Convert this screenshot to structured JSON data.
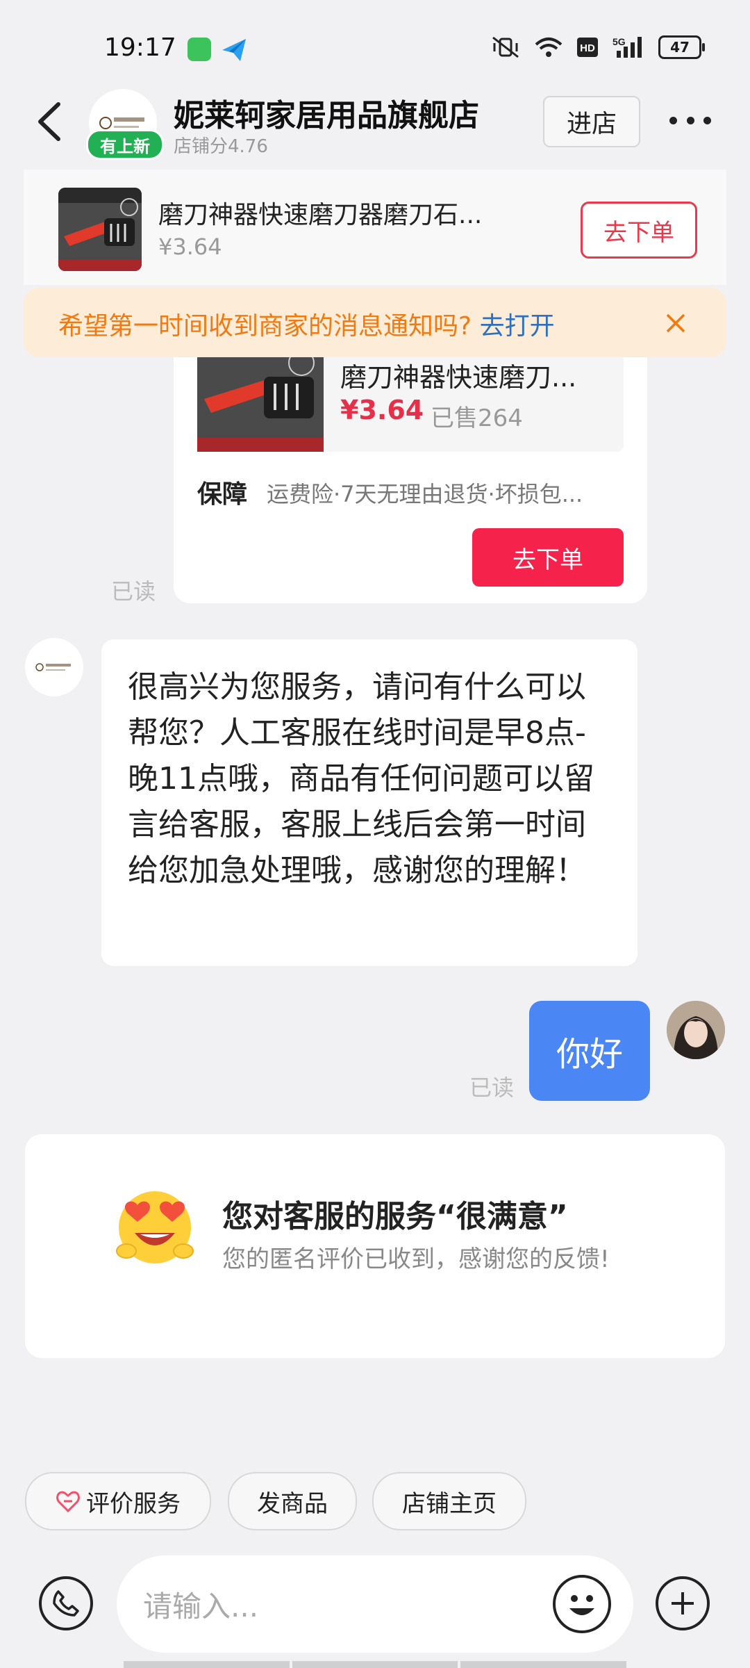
{
  "status_bar": {
    "time": "19:17",
    "icons": [
      "app-badge-green",
      "app-badge-blue",
      "mute-vibrate-icon",
      "wifi-icon",
      "hd-icon",
      "5g-signal-icon"
    ],
    "battery": "47"
  },
  "header": {
    "shop_name": "妮莱轲家居用品旗舰店",
    "shop_score": "店铺分4.76",
    "new_badge": "有上新",
    "enter_label": "进店"
  },
  "product_bar": {
    "title": "磨刀神器快速磨刀器磨刀石...",
    "price": "¥3.64",
    "order_label": "去下单"
  },
  "notice": {
    "text": "希望第一时间收到商家的消息通知吗?",
    "link": "去打开"
  },
  "product_card": {
    "title": "磨刀神器快速磨刀...",
    "price": "¥3.64",
    "sold": "已售264",
    "guarantee_label": "保障",
    "guarantee_text": "运费险·7天无理由退货·坏损包...",
    "order_label": "去下单",
    "read_label": "已读"
  },
  "shop_message": {
    "text": "很高兴为您服务，请问有什么可以帮您？人工客服在线时间是早8点-晚11点哦，商品有任何问题可以留言给客服，客服上线后会第一时间给您加急处理哦，感谢您的理解！"
  },
  "user_message": {
    "text": "你好",
    "read_label": "已读"
  },
  "satisfaction": {
    "title": "您对客服的服务“很满意”",
    "subtitle": "您的匿名评价已收到，感谢您的反馈!"
  },
  "quick_actions": [
    {
      "label": "评价服务"
    },
    {
      "label": "发商品"
    },
    {
      "label": "店铺主页"
    }
  ],
  "input": {
    "placeholder": "请输入..."
  },
  "colors": {
    "accent_red": "#f5234b",
    "user_bubble": "#4b86f5",
    "notice_orange": "#f07a10",
    "new_badge_green": "#22b055"
  }
}
